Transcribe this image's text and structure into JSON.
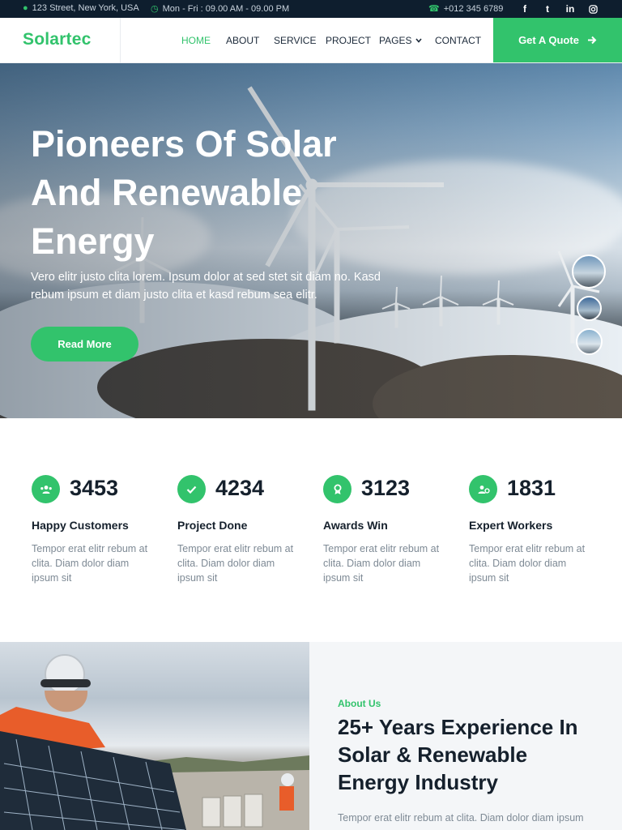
{
  "topbar": {
    "address": "123 Street, New York, USA",
    "hours": "Mon - Fri : 09.00 AM - 09.00 PM",
    "phone": "+012 345 6789",
    "social": [
      "f",
      "t",
      "in",
      "ig"
    ]
  },
  "nav": {
    "brand": "Solartec",
    "items": [
      {
        "label": "HOME",
        "active": true
      },
      {
        "label": "ABOUT"
      },
      {
        "label": "SERVICE"
      },
      {
        "label": "PROJECT"
      },
      {
        "label": "PAGES"
      },
      {
        "label": "CONTACT"
      }
    ],
    "quote_button": "Get A Quote"
  },
  "hero": {
    "title": "Pioneers Of Solar And Renewable Energy",
    "text": "Vero elitr justo clita lorem. Ipsum dolor at sed stet sit diam no. Kasd rebum ipsum et diam justo clita et kasd rebum sea elitr.",
    "button": "Read More"
  },
  "stats": [
    {
      "number": "3453",
      "label": "Happy Customers",
      "desc": "Tempor erat elitr rebum at clita. Diam dolor diam ipsum sit",
      "icon": "users-icon"
    },
    {
      "number": "4234",
      "label": "Project Done",
      "desc": "Tempor erat elitr rebum at clita. Diam dolor diam ipsum sit",
      "icon": "check-icon"
    },
    {
      "number": "3123",
      "label": "Awards Win",
      "desc": "Tempor erat elitr rebum at clita. Diam dolor diam ipsum sit",
      "icon": "award-icon"
    },
    {
      "number": "1831",
      "label": "Expert Workers",
      "desc": "Tempor erat elitr rebum at clita. Diam dolor diam ipsum sit",
      "icon": "users-cog-icon"
    }
  ],
  "about": {
    "kicker": "About Us",
    "title": "25+ Years Experience In Solar & Renewable Energy Industry",
    "text": "Tempor erat elitr rebum at clita. Diam dolor diam ipsum"
  },
  "colors": {
    "accent": "#32c36c",
    "dark": "#0e1e2e"
  }
}
